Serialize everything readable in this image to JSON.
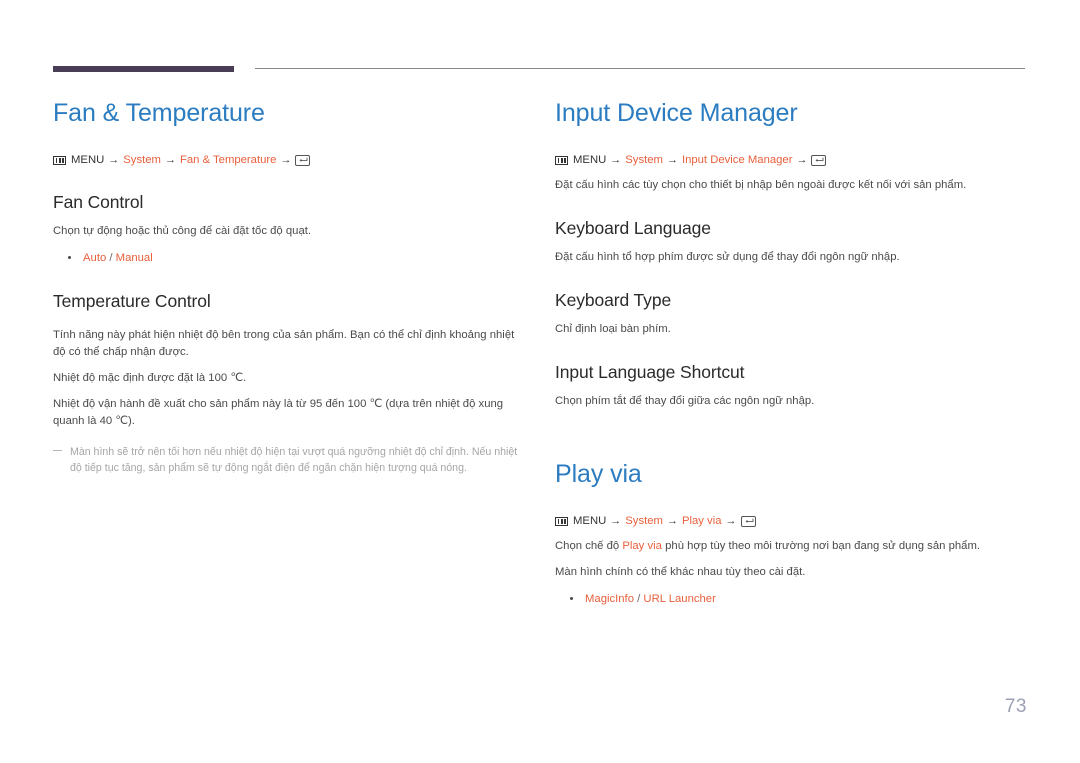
{
  "page": {
    "number": "73",
    "accent_color": "#483d55",
    "heading_color": "#2b7cc0",
    "link_color": "#e8603c",
    "body_color": "#4a4a4a",
    "note_color": "#a6a6a6"
  },
  "icons": {
    "menu": "menu-grid-icon",
    "enter": "enter-key-icon",
    "arrow": "→"
  },
  "left_column": {
    "section_title": "Fan & Temperature",
    "menu_path": {
      "menu_label": "MENU",
      "crumb1": "System",
      "crumb2": "Fan & Temperature"
    },
    "fan_control": {
      "title": "Fan Control",
      "body": "Chọn tự động hoặc thủ công để cài đặt tốc độ quạt.",
      "options": [
        "Auto",
        "Manual"
      ],
      "option_separator": "/"
    },
    "temperature_control": {
      "title": "Temperature Control",
      "body1": "Tính năng này phát hiện nhiệt độ bên trong của sản phẩm. Bạn có thể chỉ định khoảng nhiệt độ có thể chấp nhận được.",
      "body2": "Nhiệt độ mặc định được đặt là 100 ℃.",
      "body3": "Nhiệt độ vận hành đề xuất cho sản phẩm này là từ 95 đến 100 ℃ (dựa trên nhiệt độ xung quanh là 40 ℃).",
      "note": "Màn hình sẽ trở nên tối hơn nếu nhiệt độ hiện tại vượt quá ngưỡng nhiệt độ chỉ định. Nếu nhiệt độ tiếp tục tăng, sản phẩm sẽ tự động ngắt điện để ngăn chặn hiện tượng quá nóng."
    }
  },
  "right_column": {
    "input_device_manager": {
      "section_title": "Input Device Manager",
      "menu_path": {
        "menu_label": "MENU",
        "crumb1": "System",
        "crumb2": "Input Device Manager"
      },
      "body": "Đặt cấu hình các tùy chọn cho thiết bị nhập bên ngoài được kết nối với sản phẩm.",
      "keyboard_language": {
        "title": "Keyboard Language",
        "body": "Đặt cấu hình tổ hợp phím được sử dụng để thay đổi ngôn ngữ nhập."
      },
      "keyboard_type": {
        "title": "Keyboard Type",
        "body": "Chỉ định loại bàn phím."
      },
      "input_language_shortcut": {
        "title": "Input Language Shortcut",
        "body": "Chọn phím tắt để thay đổi giữa các ngôn ngữ nhập."
      }
    },
    "play_via": {
      "section_title": "Play via",
      "menu_path": {
        "menu_label": "MENU",
        "crumb1": "System",
        "crumb2": "Play via"
      },
      "body1_before": "Chọn chế độ ",
      "body1_link": "Play via",
      "body1_after": " phù hợp tùy theo môi trường nơi bạn đang sử dụng sản phẩm.",
      "body2": "Màn hình chính có thể khác nhau tùy theo cài đặt.",
      "options": [
        "MagicInfo",
        "URL Launcher"
      ],
      "option_separator": "/"
    }
  }
}
